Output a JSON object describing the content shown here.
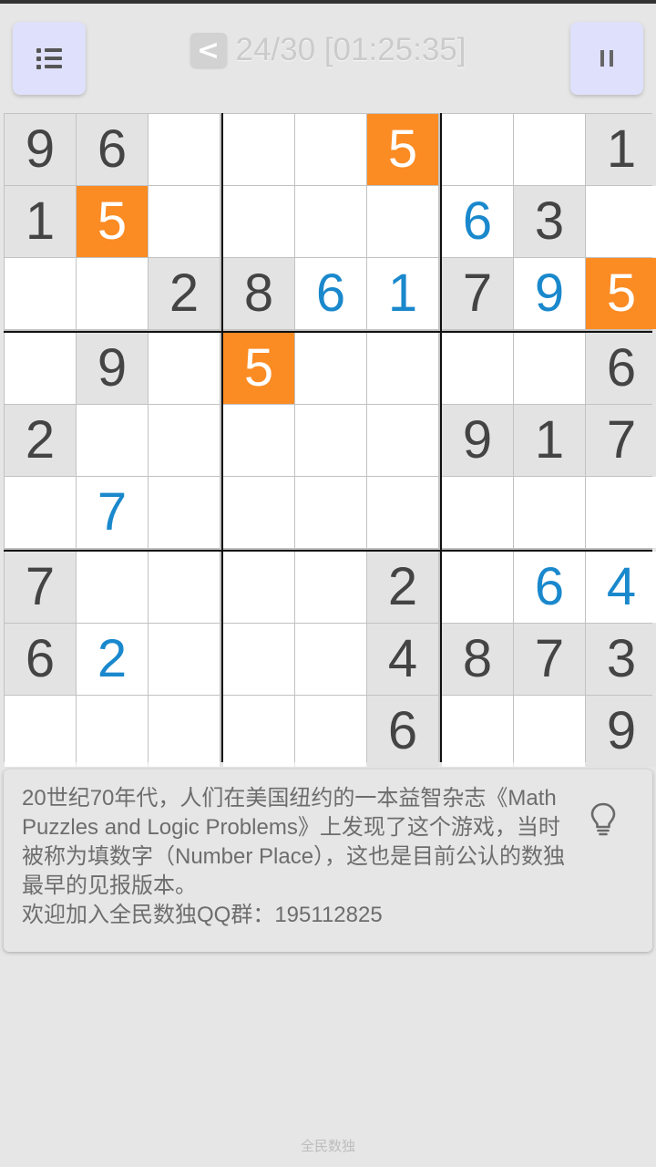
{
  "toolbar": {
    "menu_icon": "list-icon",
    "pause_icon": "pause-icon",
    "back_label": "<",
    "progress": "24/30 [01:25:35]"
  },
  "colors": {
    "given_bg": "#e3e3e3",
    "given_text": "#444444",
    "user_text": "#1a88cc",
    "highlight_bg": "#fb8b23",
    "highlight_text": "#ffffff",
    "empty_bg": "#ffffff"
  },
  "board": {
    "highlight_digit": "5",
    "cells": [
      [
        {
          "v": "9",
          "t": "given"
        },
        {
          "v": "6",
          "t": "given"
        },
        {
          "v": "",
          "t": "empty"
        },
        {
          "v": "",
          "t": "empty"
        },
        {
          "v": "",
          "t": "empty"
        },
        {
          "v": "5",
          "t": "given"
        },
        {
          "v": "",
          "t": "empty"
        },
        {
          "v": "",
          "t": "empty"
        },
        {
          "v": "1",
          "t": "given"
        }
      ],
      [
        {
          "v": "1",
          "t": "given"
        },
        {
          "v": "5",
          "t": "given"
        },
        {
          "v": "",
          "t": "empty"
        },
        {
          "v": "",
          "t": "empty"
        },
        {
          "v": "",
          "t": "empty"
        },
        {
          "v": "",
          "t": "empty"
        },
        {
          "v": "6",
          "t": "user"
        },
        {
          "v": "3",
          "t": "given"
        },
        {
          "v": "",
          "t": "empty"
        }
      ],
      [
        {
          "v": "",
          "t": "empty"
        },
        {
          "v": "",
          "t": "empty"
        },
        {
          "v": "2",
          "t": "given"
        },
        {
          "v": "8",
          "t": "given"
        },
        {
          "v": "6",
          "t": "user"
        },
        {
          "v": "1",
          "t": "user"
        },
        {
          "v": "7",
          "t": "given"
        },
        {
          "v": "9",
          "t": "user"
        },
        {
          "v": "5",
          "t": "given"
        }
      ],
      [
        {
          "v": "",
          "t": "empty"
        },
        {
          "v": "9",
          "t": "given"
        },
        {
          "v": "",
          "t": "empty"
        },
        {
          "v": "5",
          "t": "given"
        },
        {
          "v": "",
          "t": "empty"
        },
        {
          "v": "",
          "t": "empty"
        },
        {
          "v": "",
          "t": "empty"
        },
        {
          "v": "",
          "t": "empty"
        },
        {
          "v": "6",
          "t": "given"
        }
      ],
      [
        {
          "v": "2",
          "t": "given"
        },
        {
          "v": "",
          "t": "empty"
        },
        {
          "v": "",
          "t": "empty"
        },
        {
          "v": "",
          "t": "empty"
        },
        {
          "v": "",
          "t": "empty"
        },
        {
          "v": "",
          "t": "empty"
        },
        {
          "v": "9",
          "t": "given"
        },
        {
          "v": "1",
          "t": "given"
        },
        {
          "v": "7",
          "t": "given"
        }
      ],
      [
        {
          "v": "",
          "t": "empty"
        },
        {
          "v": "7",
          "t": "user"
        },
        {
          "v": "",
          "t": "empty"
        },
        {
          "v": "",
          "t": "empty"
        },
        {
          "v": "",
          "t": "empty"
        },
        {
          "v": "",
          "t": "empty"
        },
        {
          "v": "",
          "t": "empty"
        },
        {
          "v": "",
          "t": "empty"
        },
        {
          "v": "",
          "t": "empty"
        }
      ],
      [
        {
          "v": "7",
          "t": "given"
        },
        {
          "v": "",
          "t": "empty"
        },
        {
          "v": "",
          "t": "empty"
        },
        {
          "v": "",
          "t": "empty"
        },
        {
          "v": "",
          "t": "empty"
        },
        {
          "v": "2",
          "t": "given"
        },
        {
          "v": "",
          "t": "empty"
        },
        {
          "v": "6",
          "t": "user"
        },
        {
          "v": "4",
          "t": "user"
        }
      ],
      [
        {
          "v": "6",
          "t": "given"
        },
        {
          "v": "2",
          "t": "user"
        },
        {
          "v": "",
          "t": "empty"
        },
        {
          "v": "",
          "t": "empty"
        },
        {
          "v": "",
          "t": "empty"
        },
        {
          "v": "4",
          "t": "given"
        },
        {
          "v": "8",
          "t": "given"
        },
        {
          "v": "7",
          "t": "given"
        },
        {
          "v": "3",
          "t": "given"
        }
      ],
      [
        {
          "v": "",
          "t": "empty"
        },
        {
          "v": "",
          "t": "empty"
        },
        {
          "v": "",
          "t": "empty"
        },
        {
          "v": "",
          "t": "empty"
        },
        {
          "v": "",
          "t": "empty"
        },
        {
          "v": "6",
          "t": "given"
        },
        {
          "v": "",
          "t": "empty"
        },
        {
          "v": "",
          "t": "empty"
        },
        {
          "v": "9",
          "t": "given"
        }
      ]
    ]
  },
  "info": {
    "text": "20世纪70年代，人们在美国纽约的一本益智杂志《Math Puzzles and Logic Problems》上发现了这个游戏，当时被称为填数字（Number Place），这也是目前公认的数独最早的见报版本。\n欢迎加入全民数独QQ群：195112825",
    "hint_icon": "lightbulb-icon"
  },
  "footer": {
    "label": "全民数独"
  }
}
